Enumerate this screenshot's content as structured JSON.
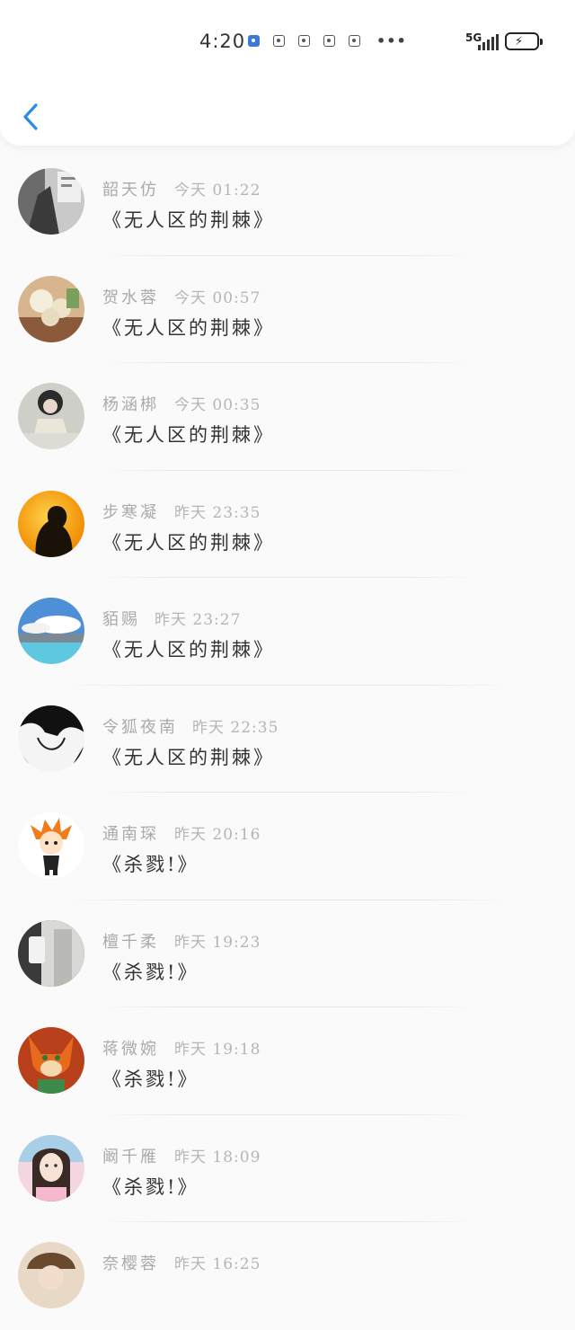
{
  "status_bar": {
    "time": "4:20",
    "more": "•••",
    "network": "5G"
  },
  "colors": {
    "accent": "#2a8be6",
    "name_text": "#aaaaaa",
    "message_text": "#333333"
  },
  "header": {
    "back_icon": "chevron-left-icon"
  },
  "messages": [
    {
      "name": "韶天仿",
      "time": "今天 01:22",
      "text": "《无人区的荆棘》"
    },
    {
      "name": "贺水蓉",
      "time": "今天 00:57",
      "text": "《无人区的荆棘》"
    },
    {
      "name": "杨涵梆",
      "time": "今天 00:35",
      "text": "《无人区的荆棘》"
    },
    {
      "name": "步寒凝",
      "time": "昨天 23:35",
      "text": "《无人区的荆棘》"
    },
    {
      "name": "貊赐",
      "time": "昨天 23:27",
      "text": "《无人区的荆棘》"
    },
    {
      "name": "令狐夜南",
      "time": "昨天 22:35",
      "text": "《无人区的荆棘》"
    },
    {
      "name": "通南琛",
      "time": "昨天 20:16",
      "text": "《杀戮!》"
    },
    {
      "name": "檀千柔",
      "time": "昨天 19:23",
      "text": "《杀戮!》"
    },
    {
      "name": "蒋微婉",
      "time": "昨天 19:18",
      "text": "《杀戮!》"
    },
    {
      "name": "阚千雁",
      "time": "昨天 18:09",
      "text": "《杀戮!》"
    },
    {
      "name": "奈樱蓉",
      "time": "昨天 16:25",
      "text": ""
    }
  ]
}
